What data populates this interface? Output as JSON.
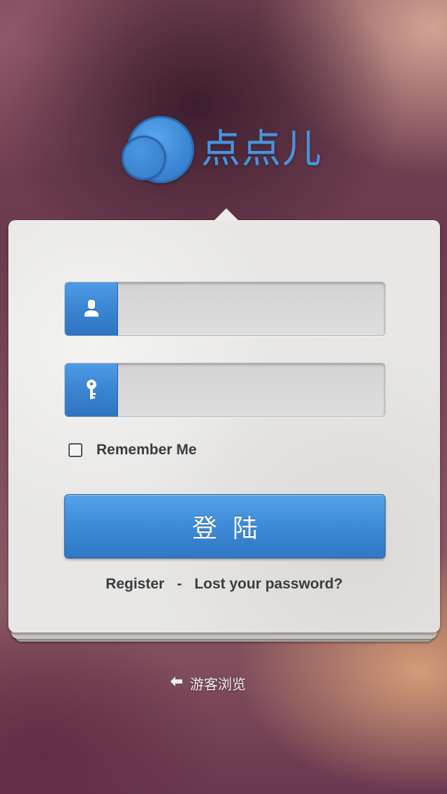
{
  "logo": {
    "text": "点点儿",
    "icon": "two-circles-logo"
  },
  "form": {
    "username": {
      "icon": "user-icon",
      "value": "",
      "placeholder": ""
    },
    "password": {
      "icon": "key-icon",
      "value": "",
      "placeholder": ""
    },
    "remember_label": "Remember Me",
    "remember_checked": false,
    "login_label": "登陆",
    "register_label": "Register",
    "separator": "-",
    "lost_password_label": "Lost your password?"
  },
  "guest": {
    "icon": "arrow-left-icon",
    "label": "游客浏览"
  },
  "colors": {
    "accent": "#3d8ad6",
    "card": "#e8e7e5",
    "text_dark": "#3c3c3c"
  }
}
